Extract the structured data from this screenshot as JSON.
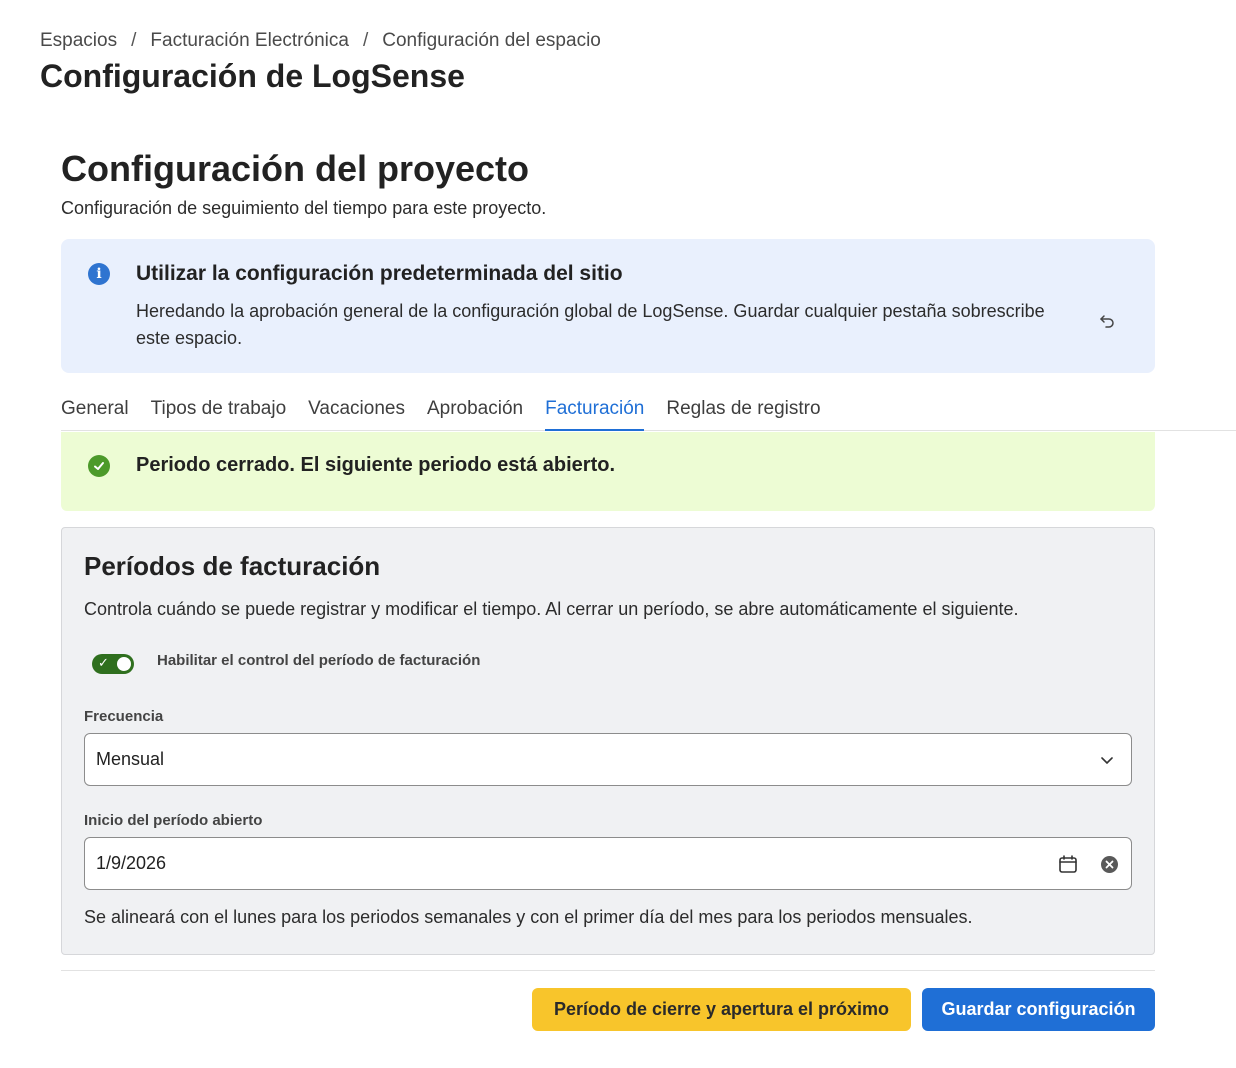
{
  "breadcrumb": {
    "items": [
      "Espacios",
      "Facturación Electrónica"
    ],
    "current": "Configuración del espacio",
    "separator": "/"
  },
  "page_title": "Configuración de LogSense",
  "project": {
    "title": "Configuración del proyecto",
    "subtitle": "Configuración de seguimiento del tiempo para este proyecto."
  },
  "info_banner": {
    "icon": "info-icon",
    "title": "Utilizar la configuración predeterminada del sitio",
    "text": "Heredando la aprobación general de la configuración global de LogSense. Guardar cualquier pestaña sobrescribe este espacio.",
    "action_icon": "undo-icon",
    "bg_color": "#e9f0fd",
    "icon_color": "#2f74d0"
  },
  "tabs": [
    {
      "label": "General",
      "active": false
    },
    {
      "label": "Tipos de trabajo",
      "active": false
    },
    {
      "label": "Vacaciones",
      "active": false
    },
    {
      "label": "Aprobación",
      "active": false
    },
    {
      "label": "Facturación",
      "active": true
    },
    {
      "label": "Reglas de registro",
      "active": false
    }
  ],
  "success_banner": {
    "icon": "check-circle-icon",
    "text": "Periodo cerrado. El siguiente periodo está abierto.",
    "bg_color": "#edfcd4",
    "icon_color": "#4c9a2a"
  },
  "billing": {
    "title": "Períodos de facturación",
    "description": "Controla cuándo se puede registrar y modificar el tiempo. Al cerrar un período, se abre automáticamente el siguiente.",
    "toggle": {
      "label": "Habilitar el control del período de facturación",
      "checked": true,
      "color": "#2f6f1e"
    },
    "frequency": {
      "label": "Frecuencia",
      "value": "Mensual"
    },
    "open_period_start": {
      "label": "Inicio del período abierto",
      "value": "1/9/2026"
    },
    "help_text": "Se alineará con el lunes para los periodos semanales y con el primer día del mes para los periodos mensuales."
  },
  "actions": {
    "close_period_label": "Período de cierre y apertura el próximo",
    "save_label": "Guardar configuración",
    "close_color": "#f8c52b",
    "save_color": "#1f6fd6"
  }
}
